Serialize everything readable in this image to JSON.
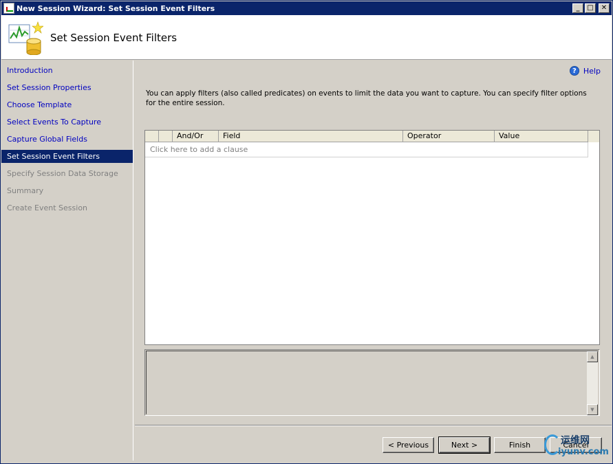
{
  "window": {
    "title": "New Session Wizard: Set Session Event Filters",
    "controls": {
      "minimize": "_",
      "maximize": "□",
      "close": "✕"
    }
  },
  "header": {
    "title": "Set Session Event Filters",
    "icon": "chart-database-icon"
  },
  "sidebar": {
    "items": [
      {
        "label": "Introduction",
        "state": "link"
      },
      {
        "label": "Set Session Properties",
        "state": "link"
      },
      {
        "label": "Choose Template",
        "state": "link"
      },
      {
        "label": "Select Events To Capture",
        "state": "link"
      },
      {
        "label": "Capture Global Fields",
        "state": "link"
      },
      {
        "label": "Set Session Event Filters",
        "state": "active"
      },
      {
        "label": "Specify Session Data Storage",
        "state": "disabled"
      },
      {
        "label": "Summary",
        "state": "disabled"
      },
      {
        "label": "Create Event Session",
        "state": "disabled"
      }
    ]
  },
  "main": {
    "help_label": "Help",
    "description": "You can apply filters (also called predicates) on events to limit the data you want to capture. You can specify filter options for the entire session.",
    "grid": {
      "columns": [
        "",
        "",
        "And/Or",
        "Field",
        "Operator",
        "Value"
      ],
      "placeholder_row": "Click here to add a clause"
    }
  },
  "footer": {
    "previous": "< Previous",
    "next": "Next >",
    "finish": "Finish",
    "cancel": "Cancel"
  },
  "watermark": {
    "text": "运维网",
    "url": "iyunv.com"
  },
  "colors": {
    "titlebar": "#0a246a",
    "active_nav": "#0a246a",
    "link": "#0000c0",
    "disabled": "#808080"
  }
}
